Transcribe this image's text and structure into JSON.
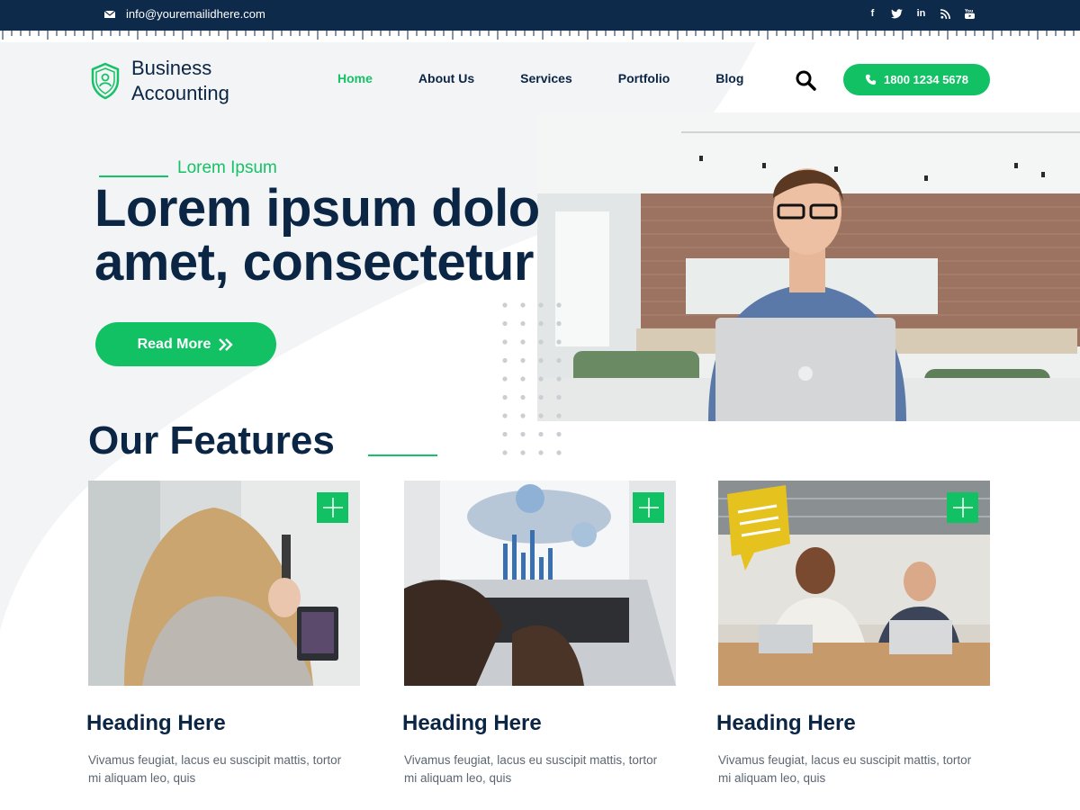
{
  "topbar": {
    "email": "info@youremailidhere.com",
    "socials": [
      "facebook-icon",
      "twitter-icon",
      "linkedin-icon",
      "rss-icon",
      "youtube-icon"
    ]
  },
  "header": {
    "logo_line1": "Business",
    "logo_line2": "Accounting",
    "nav": [
      "Home",
      "About Us",
      "Services",
      "Portfolio",
      "Blog"
    ],
    "active_nav": "Home",
    "phone": "1800 1234 5678"
  },
  "hero": {
    "eyebrow": "Lorem Ipsum",
    "title_line1": "Lorem ipsum dolo",
    "title_line2": "amet, consectetur",
    "button": "Read More"
  },
  "features": {
    "title": "Our Features",
    "cards": [
      {
        "heading": "Heading Here",
        "text": "Vivamus feugiat, lacus eu suscipit mattis, tortor mi aliquam leo, quis"
      },
      {
        "heading": "Heading Here",
        "text": "Vivamus feugiat, lacus eu suscipit mattis, tortor mi aliquam leo, quis"
      },
      {
        "heading": "Heading Here",
        "text": "Vivamus feugiat, lacus eu suscipit mattis, tortor mi aliquam leo, quis"
      }
    ]
  },
  "colors": {
    "navy": "#0d2a4a",
    "green": "#13c165",
    "text_gray": "#5c6670"
  }
}
